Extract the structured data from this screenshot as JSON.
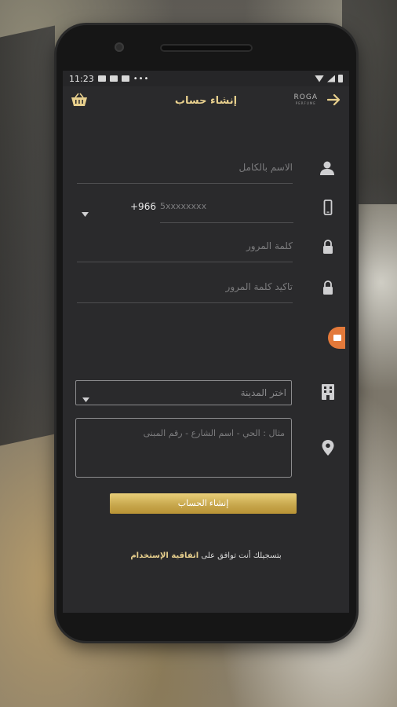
{
  "status_bar": {
    "time": "11:23",
    "dots": "•••"
  },
  "app_bar": {
    "title": "إنشاء حساب",
    "logo_main": "ROGA",
    "logo_sub": "PERFUME"
  },
  "form": {
    "full_name_placeholder": "الاسم بالكامل",
    "country_code": "+966",
    "phone_placeholder": "5xxxxxxxx",
    "password_placeholder": "كلمة المرور",
    "confirm_password_placeholder": "تاكيد كلمة المرور",
    "city_select_value": "اختر المدينة",
    "address_placeholder": "مثال : الحي - اسم الشارع - رقم المبنى"
  },
  "submit": {
    "label": "إنشاء الحساب"
  },
  "terms": {
    "text": "بتسجيلك أنت توافق على",
    "link": "اتفاقية الإستخدام"
  },
  "colors": {
    "accent": "#e7cf8d",
    "screen_bg": "#2a2a2c",
    "float_tab": "#e3793a"
  },
  "icons": [
    "cart-icon",
    "back-arrow-icon",
    "user-icon",
    "mobile-icon",
    "lock-icon",
    "building-icon",
    "location-pin-icon",
    "caret-down-icon"
  ]
}
